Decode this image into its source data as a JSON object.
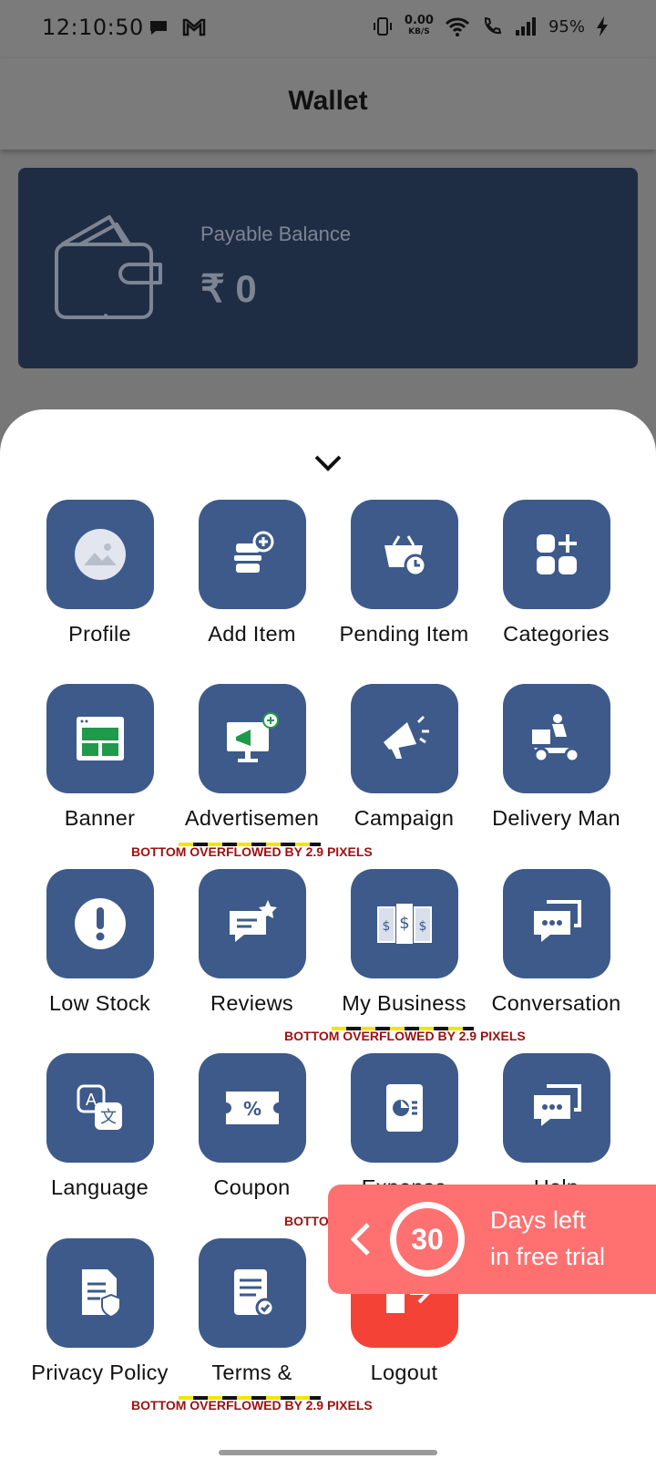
{
  "status_bar": {
    "time": "12:10:50",
    "net_speed": "0.00",
    "net_unit": "KB/S",
    "battery": "95%"
  },
  "appbar": {
    "title": "Wallet"
  },
  "wallet": {
    "label": "Payable Balance",
    "value": "₹ 0"
  },
  "menu": {
    "items": [
      {
        "label": "Profile",
        "icon": "profile-image-icon"
      },
      {
        "label": "Add Item",
        "icon": "add-item-icon"
      },
      {
        "label": "Pending Item",
        "icon": "pending-basket-icon"
      },
      {
        "label": "Categories",
        "icon": "categories-icon"
      },
      {
        "label": "Banner",
        "icon": "banner-icon"
      },
      {
        "label": "Advertisemen",
        "icon": "advertisement-icon"
      },
      {
        "label": "Campaign",
        "icon": "megaphone-icon"
      },
      {
        "label": "Delivery Man",
        "icon": "delivery-scooter-icon"
      },
      {
        "label": "Low Stock",
        "icon": "exclamation-icon"
      },
      {
        "label": "Reviews",
        "icon": "review-chat-star-icon"
      },
      {
        "label": "My Business",
        "icon": "business-money-icon"
      },
      {
        "label": "Conversation",
        "icon": "conversation-icon"
      },
      {
        "label": "Language",
        "icon": "language-translate-icon"
      },
      {
        "label": "Coupon",
        "icon": "coupon-icon"
      },
      {
        "label": "Expense",
        "icon": "expense-report-icon"
      },
      {
        "label": "Help",
        "icon": "help-chat-icon"
      },
      {
        "label": "Privacy Policy",
        "icon": "privacy-policy-icon"
      },
      {
        "label": "Terms &",
        "icon": "terms-icon"
      },
      {
        "label": "Logout",
        "icon": "logout-icon"
      }
    ],
    "overflow_text": "BOTTOM OVERFLOWED BY 2.9 PIXELS",
    "overflow_partial": "BOTTO"
  },
  "trial": {
    "days": "30",
    "line1": "Days left",
    "line2": "in free trial"
  },
  "colors": {
    "tile": "#3d5a8a",
    "logout": "#f44336",
    "trial": "#ff7070",
    "card": "#1f2d44"
  }
}
